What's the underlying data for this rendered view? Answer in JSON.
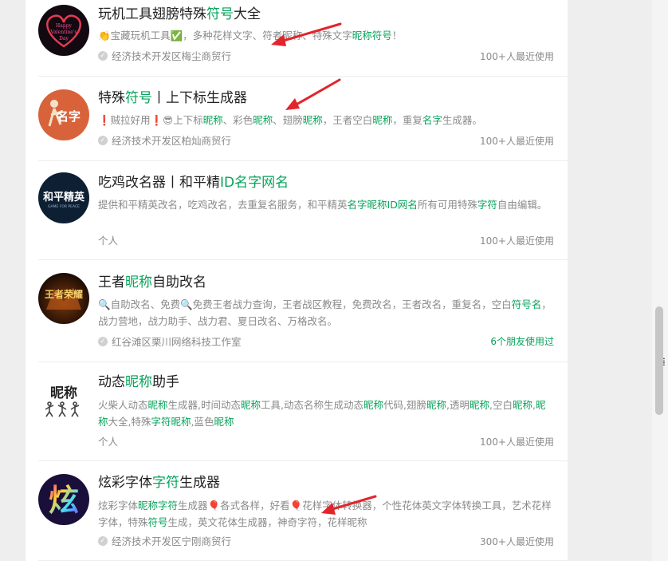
{
  "results": [
    {
      "title_parts": [
        {
          "t": "玩机工具翅膀特殊",
          "hl": false
        },
        {
          "t": "符号",
          "hl": true
        },
        {
          "t": "大全",
          "hl": false
        }
      ],
      "desc_parts": [
        {
          "t": "👏",
          "hl": false
        },
        {
          "t": "宝藏玩机工具",
          "hl": false
        },
        {
          "t": "✅",
          "hl": false
        },
        {
          "t": "，多种花样文字、",
          "hl": false
        },
        {
          "t": "符者昵称、特殊文字",
          "hl": false
        },
        {
          "t": "昵称符号",
          "hl": true
        },
        {
          "t": "！",
          "hl": false
        }
      ],
      "owner": "经济技术开发区梅尘商贸行",
      "verified": true,
      "usage": "100+人最近使用",
      "usage_friend": false,
      "avatar": {
        "kind": "valentine",
        "text": "Happy Valentine's Day"
      }
    },
    {
      "title_parts": [
        {
          "t": "特殊",
          "hl": false
        },
        {
          "t": "符号",
          "hl": true
        },
        {
          "t": "丨上下标生成器",
          "hl": false
        }
      ],
      "desc_parts": [
        {
          "t": "❗",
          "hl": false
        },
        {
          "t": "贼拉好用",
          "hl": false
        },
        {
          "t": "❗",
          "hl": false
        },
        {
          "t": "😎",
          "hl": false
        },
        {
          "t": "上下标",
          "hl": false
        },
        {
          "t": "昵称",
          "hl": true
        },
        {
          "t": "、彩色",
          "hl": false
        },
        {
          "t": "昵称",
          "hl": true
        },
        {
          "t": "、翅膀",
          "hl": false
        },
        {
          "t": "昵称",
          "hl": true
        },
        {
          "t": "，王者空白",
          "hl": false
        },
        {
          "t": "昵称",
          "hl": true
        },
        {
          "t": "，重复",
          "hl": false
        },
        {
          "t": "名字",
          "hl": true
        },
        {
          "t": "生成器。",
          "hl": false
        }
      ],
      "owner": "经济技术开发区柏灿商贸行",
      "verified": true,
      "usage": "100+人最近使用",
      "usage_friend": false,
      "avatar": {
        "kind": "mingzi",
        "text": "名字"
      }
    },
    {
      "title_parts": [
        {
          "t": "吃鸡改名器丨和平精",
          "hl": false
        },
        {
          "t": "ID名字网名",
          "hl": true
        }
      ],
      "desc_parts": [
        {
          "t": "提供和平精英改名，吃鸡改名，去重复名服务，和平精英",
          "hl": false
        },
        {
          "t": "名字昵称ID网名",
          "hl": true
        },
        {
          "t": "所有可用特殊",
          "hl": false
        },
        {
          "t": "字符",
          "hl": true
        },
        {
          "t": "自由编辑。",
          "hl": false
        }
      ],
      "owner": "个人",
      "verified": false,
      "usage": "100+人最近使用",
      "usage_friend": false,
      "avatar": {
        "kind": "peace",
        "text": "和平精英",
        "sub": "GAME FOR PEACE"
      }
    },
    {
      "title_parts": [
        {
          "t": "王者",
          "hl": false
        },
        {
          "t": "昵称",
          "hl": true
        },
        {
          "t": "自助改名",
          "hl": false
        }
      ],
      "desc_parts": [
        {
          "t": "🔍",
          "hl": false
        },
        {
          "t": "自助改名、免费",
          "hl": false
        },
        {
          "t": "🔍",
          "hl": false
        },
        {
          "t": "免费王者战力查询，王者战区教程，免费改名，王者改名，重复名，空白",
          "hl": false
        },
        {
          "t": "符号名",
          "hl": true
        },
        {
          "t": "，战力营地，战力助手、战力君、夏日改名、万格改名。",
          "hl": false
        }
      ],
      "owner": "红谷滩区栗川网络科技工作室",
      "verified": true,
      "usage": "6个朋友使用过",
      "usage_friend": true,
      "avatar": {
        "kind": "wangzhe",
        "text": "王者荣耀"
      }
    },
    {
      "title_parts": [
        {
          "t": "动态",
          "hl": false
        },
        {
          "t": "昵称",
          "hl": true
        },
        {
          "t": "助手",
          "hl": false
        }
      ],
      "desc_parts": [
        {
          "t": "火柴人动态",
          "hl": false
        },
        {
          "t": "昵称",
          "hl": true
        },
        {
          "t": "生成器,时间动态",
          "hl": false
        },
        {
          "t": "昵称",
          "hl": true
        },
        {
          "t": "工具,动态名称生成动态",
          "hl": false
        },
        {
          "t": "昵称",
          "hl": true
        },
        {
          "t": "代码,翅膀",
          "hl": false
        },
        {
          "t": "昵称",
          "hl": true
        },
        {
          "t": ",透明",
          "hl": false
        },
        {
          "t": "昵称",
          "hl": true
        },
        {
          "t": ",空白",
          "hl": false
        },
        {
          "t": "昵称",
          "hl": true
        },
        {
          "t": ",",
          "hl": false
        },
        {
          "t": "昵称",
          "hl": true
        },
        {
          "t": "大全,特殊",
          "hl": false
        },
        {
          "t": "字符昵称",
          "hl": true
        },
        {
          "t": ",蓝色",
          "hl": false
        },
        {
          "t": "昵称",
          "hl": true
        }
      ],
      "owner": "个人",
      "verified": false,
      "usage": "100+人最近使用",
      "usage_friend": false,
      "avatar": {
        "kind": "nicheng",
        "text": "昵称"
      }
    },
    {
      "title_parts": [
        {
          "t": "炫彩字体",
          "hl": false
        },
        {
          "t": "字符",
          "hl": true
        },
        {
          "t": "生成器",
          "hl": false
        }
      ],
      "desc_parts": [
        {
          "t": "炫彩字体",
          "hl": false
        },
        {
          "t": "昵称字符",
          "hl": true
        },
        {
          "t": "生成器",
          "hl": false
        },
        {
          "t": "🎈",
          "hl": false
        },
        {
          "t": "各式各样，好看",
          "hl": false
        },
        {
          "t": "🎈",
          "hl": false
        },
        {
          "t": "花样字体转换器，个性花体英文字体转换工具，艺术花样字体，特殊",
          "hl": false
        },
        {
          "t": "符号",
          "hl": true
        },
        {
          "t": "生成，英文花体生成器，神奇字符，花样昵称",
          "hl": false
        }
      ],
      "owner": "经济技术开发区宁刚商贸行",
      "verified": true,
      "usage": "300+人最近使用",
      "usage_friend": false,
      "avatar": {
        "kind": "xuan",
        "text": "炫"
      }
    }
  ],
  "colors": {
    "highlight": "#07a35a",
    "arrow": "#e3242b"
  },
  "icons": [
    "verified-check-icon",
    "annotation-arrow-icon",
    "scrollbar-thumb"
  ]
}
